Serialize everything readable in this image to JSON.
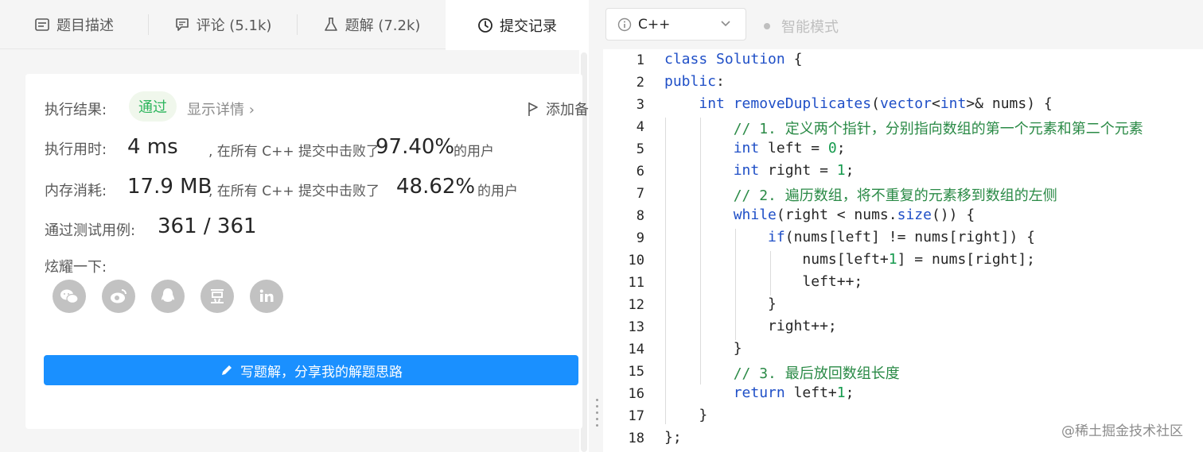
{
  "tabs": [
    {
      "label": "题目描述",
      "icon": "description-icon"
    },
    {
      "label": "评论 (5.1k)",
      "icon": "comment-icon"
    },
    {
      "label": "题解 (7.2k)",
      "icon": "flask-icon"
    },
    {
      "label": "提交记录",
      "icon": "clock-icon"
    }
  ],
  "result": {
    "label": "执行结果:",
    "status": "通过",
    "details": "显示详情 ›",
    "add_note": "添加备"
  },
  "runtime": {
    "label": "执行用时:",
    "value": "4 ms",
    "mid": ", 在所有 C++ 提交中击败了",
    "percent": "97.40%",
    "suffix": "的用户"
  },
  "memory": {
    "label": "内存消耗:",
    "value": "17.9 MB",
    "mid": ", 在所有 C++ 提交中击败了",
    "percent": "48.62%",
    "suffix": "的用户"
  },
  "tests": {
    "label": "通过测试用例:",
    "value": "361 / 361"
  },
  "share": {
    "label": "炫耀一下:",
    "icons": [
      "wechat-icon",
      "weibo-icon",
      "qq-icon",
      "douban-icon",
      "linkedin-icon"
    ]
  },
  "write_solution": "写题解，分享我的解题思路",
  "editor": {
    "language": "C++",
    "smart_mode": "智能模式",
    "line_numbers": [
      "1",
      "2",
      "3",
      "4",
      "5",
      "6",
      "7",
      "8",
      "9",
      "10",
      "11",
      "12",
      "13",
      "14",
      "15",
      "16",
      "17",
      "18"
    ]
  },
  "watermark": "@稀土掘金技术社区"
}
